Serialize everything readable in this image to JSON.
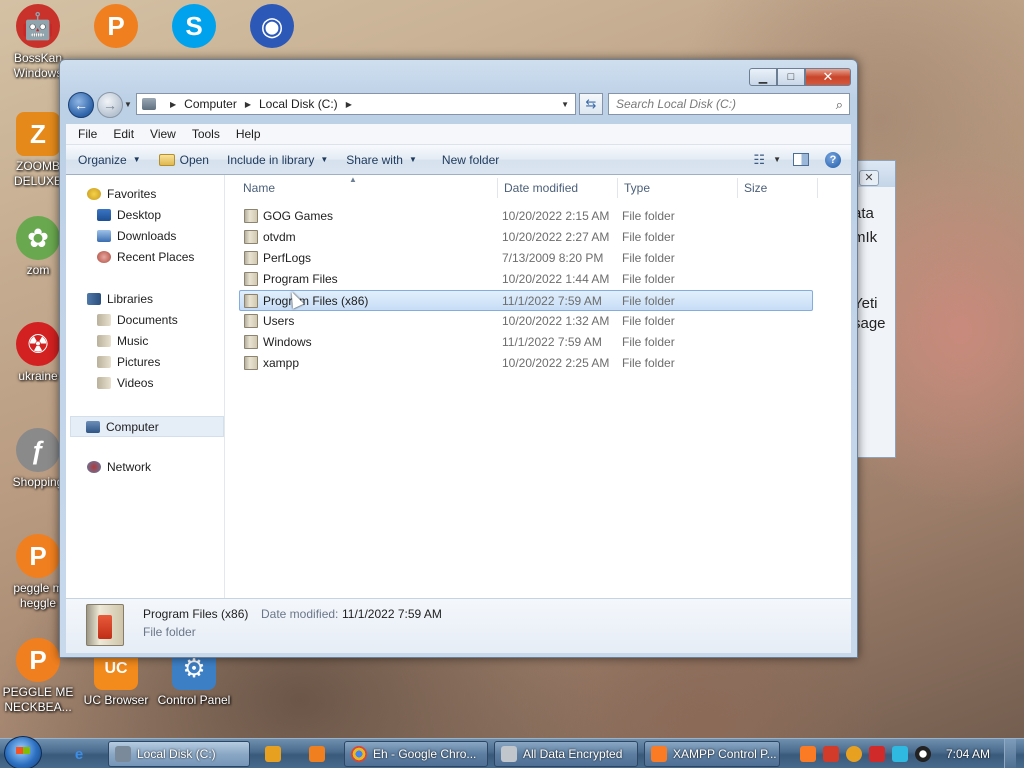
{
  "desktop": {
    "icons": [
      {
        "label": "BossKan Windows",
        "glyph": "🤖",
        "color": "#c8322a"
      },
      {
        "label": "ZOOMB DELUXE",
        "glyph": "Z",
        "color": "#e58a1a"
      },
      {
        "label": "zom",
        "glyph": "✿",
        "color": "#6aa84f"
      },
      {
        "label": "ukraine",
        "glyph": "☢",
        "color": "#d32020"
      },
      {
        "label": "Shopping",
        "glyph": "ƒ",
        "color": "#8a8a8a"
      },
      {
        "label": "peggle m heggle",
        "glyph": "P",
        "color": "#f07f1f"
      },
      {
        "label": "PEGGLE ME NECKBEA...",
        "glyph": "P",
        "color": "#f07f1f"
      },
      {
        "label": "UC Browser",
        "glyph": "UC",
        "color": "#f28a1c"
      },
      {
        "label": "Control Panel",
        "glyph": "⚙",
        "color": "#3d7fc4"
      }
    ],
    "top_icons": [
      {
        "name": "peggle-p",
        "glyph": "P",
        "color": "#f07f1f"
      },
      {
        "name": "skype",
        "glyph": "S",
        "color": "#00a2ed"
      },
      {
        "name": "globe",
        "glyph": "◉",
        "color": "#2c58b8"
      }
    ]
  },
  "background_window": {
    "text_lines": [
      "ata",
      "mIk",
      "Yeti",
      "sage"
    ]
  },
  "explorer": {
    "address": {
      "segments": [
        "Computer",
        "Local Disk (C:)"
      ]
    },
    "search_placeholder": "Search Local Disk (C:)",
    "menu": [
      "File",
      "Edit",
      "View",
      "Tools",
      "Help"
    ],
    "toolbar": {
      "organize": "Organize",
      "open": "Open",
      "include_in_library": "Include in library",
      "share_with": "Share with",
      "new_folder": "New folder"
    },
    "nav": {
      "favorites": "Favorites",
      "desktop": "Desktop",
      "downloads": "Downloads",
      "recent_places": "Recent Places",
      "libraries": "Libraries",
      "documents": "Documents",
      "music": "Music",
      "pictures": "Pictures",
      "videos": "Videos",
      "computer": "Computer",
      "network": "Network"
    },
    "columns": {
      "name": "Name",
      "date_modified": "Date modified",
      "type": "Type",
      "size": "Size"
    },
    "files": [
      {
        "name": "GOG Games",
        "date": "10/20/2022 2:15 AM",
        "type": "File folder"
      },
      {
        "name": "otvdm",
        "date": "10/20/2022 2:27 AM",
        "type": "File folder"
      },
      {
        "name": "PerfLogs",
        "date": "7/13/2009 8:20 PM",
        "type": "File folder"
      },
      {
        "name": "Program Files",
        "date": "10/20/2022 1:44 AM",
        "type": "File folder"
      },
      {
        "name": "Program Files (x86)",
        "date": "11/1/2022 7:59 AM",
        "type": "File folder"
      },
      {
        "name": "Users",
        "date": "10/20/2022 1:32 AM",
        "type": "File folder"
      },
      {
        "name": "Windows",
        "date": "11/1/2022 7:59 AM",
        "type": "File folder"
      },
      {
        "name": "xampp",
        "date": "10/20/2022 2:25 AM",
        "type": "File folder"
      }
    ],
    "details": {
      "name": "Program Files (x86)",
      "date_label": "Date modified:",
      "date_value": "11/1/2022 7:59 AM",
      "type": "File folder"
    }
  },
  "taskbar": {
    "tasks": [
      {
        "label": "Local Disk (C:)",
        "active": true,
        "color": "#7a8a9a"
      },
      {
        "label": "Eh - Google Chro...",
        "active": false,
        "color": "#e8b920"
      },
      {
        "label": "All Data Encrypted",
        "active": false,
        "color": "#c0c6cc"
      },
      {
        "label": "XAMPP Control P...",
        "active": false,
        "color": "#fb7a24"
      }
    ],
    "clock": "7:04 AM"
  }
}
